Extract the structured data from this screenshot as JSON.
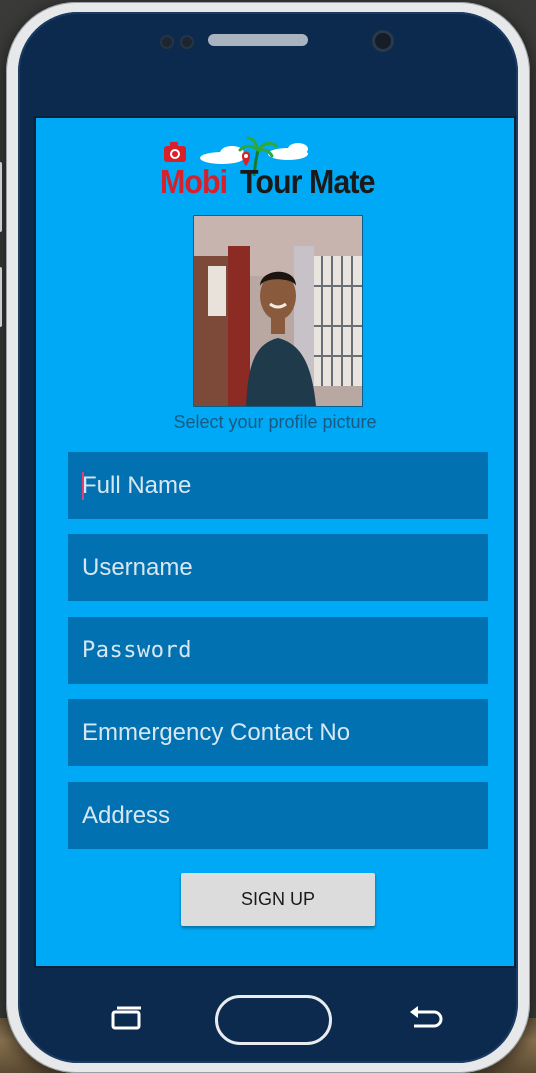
{
  "app": {
    "logo_word1": "Mobi",
    "logo_word2": "Tour Mate"
  },
  "profile": {
    "caption": "Select your profile picture"
  },
  "form": {
    "full_name_placeholder": "Full Name",
    "username_placeholder": "Username",
    "password_placeholder": "Password",
    "emergency_placeholder": "Emmergency Contact No",
    "address_placeholder": "Address",
    "signup_label": "SIGN UP"
  },
  "icons": {
    "logo": "camera-map-pin-palm-icon",
    "recents": "recents-icon",
    "home": "home-button",
    "back": "back-arrow-icon"
  },
  "colors": {
    "screen_bg": "#00a9f6",
    "field_bg": "#0271b1",
    "logo_red": "#d8202a",
    "button_bg": "#dcdcdc"
  }
}
